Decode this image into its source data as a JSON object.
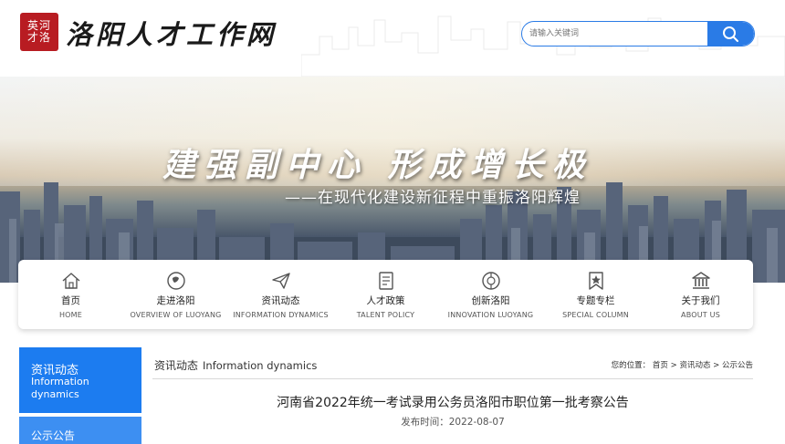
{
  "header": {
    "logo_seal_text": "英河才洛",
    "site_title": "洛阳人才工作网",
    "search": {
      "placeholder": "请输入关键词",
      "icon": "search-icon"
    }
  },
  "banner": {
    "slogan": "建强副中心 形成增长极",
    "subtitle": "——在现代化建设新征程中重振洛阳辉煌"
  },
  "nav": {
    "items": [
      {
        "label": "首页",
        "en": "HOME",
        "icon": "home-icon"
      },
      {
        "label": "走进洛阳",
        "en": "OVERVIEW OF LUOYANG",
        "icon": "globe-icon"
      },
      {
        "label": "资讯动态",
        "en": "INFORMATION DYNAMICS",
        "icon": "paper-plane-icon"
      },
      {
        "label": "人才政策",
        "en": "TALENT POLICY",
        "icon": "document-icon"
      },
      {
        "label": "创新洛阳",
        "en": "INNOVATION LUOYANG",
        "icon": "innovation-icon"
      },
      {
        "label": "专题专栏",
        "en": "SPECIAL COLUMN",
        "icon": "badge-icon"
      },
      {
        "label": "关于我们",
        "en": "ABOUT US",
        "icon": "building-icon"
      }
    ]
  },
  "sidebar": {
    "items": [
      {
        "label": "资讯动态",
        "en": "Information dynamics"
      },
      {
        "label": "公示公告"
      }
    ]
  },
  "section": {
    "title": "资讯动态",
    "title_en": "Information dynamics"
  },
  "breadcrumb": {
    "prefix": "您的位置：",
    "items": [
      "首页",
      "资讯动态",
      "公示公告"
    ],
    "separator": ">"
  },
  "article": {
    "title": "河南省2022年统一考试录用公务员洛阳市职位第一批考察公告",
    "date": "发布时间：2022-08-07"
  },
  "colors": {
    "primary_blue": "#1c7cf0",
    "seal_red": "#b81c22"
  }
}
